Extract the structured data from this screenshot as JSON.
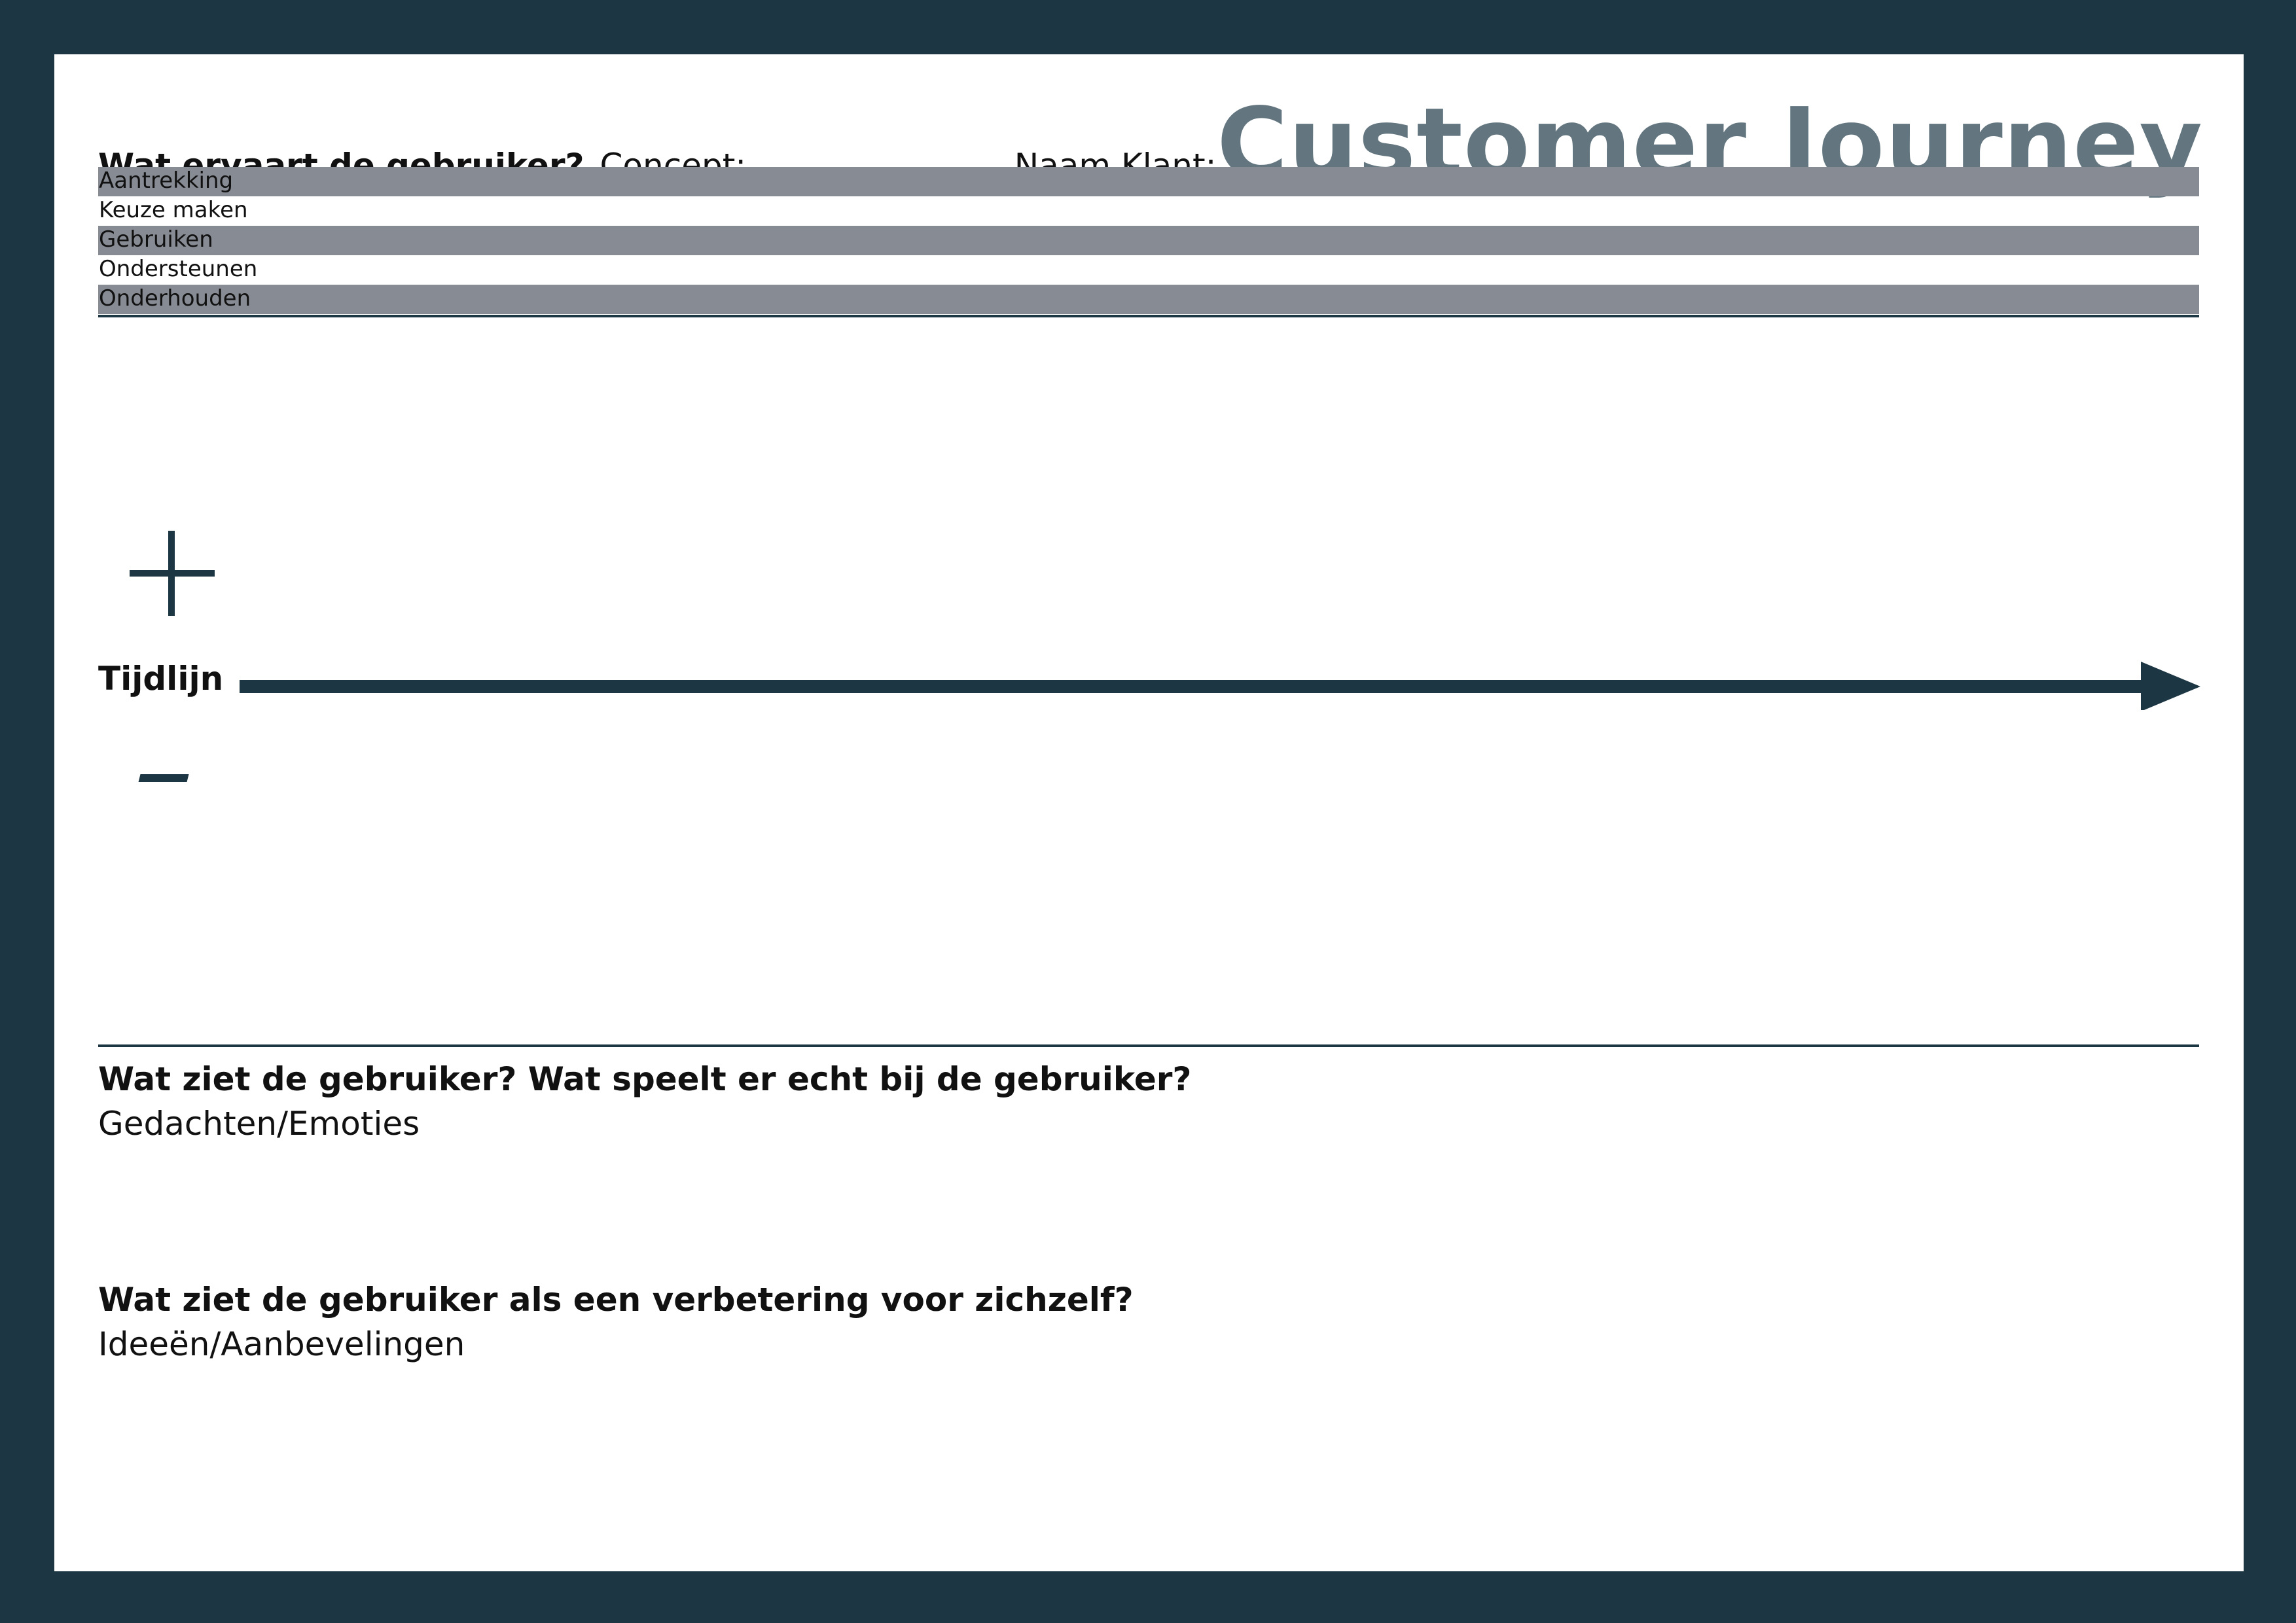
{
  "header": {
    "question": "Wat ervaart de gebruiker?",
    "concept_field": "Concept: ......................",
    "client_field": "Naam Klant: .................",
    "title": "Customer Journey"
  },
  "phases": [
    {
      "label": "Aantrekking",
      "shaded": true
    },
    {
      "label": "Keuze maken",
      "shaded": false
    },
    {
      "label": "Gebruiken",
      "shaded": true
    },
    {
      "label": "Ondersteunen",
      "shaded": false
    },
    {
      "label": "Onderhouden",
      "shaded": true
    }
  ],
  "timeline": {
    "label": "Tijdlijn",
    "positive_symbol": "+",
    "negative_symbol": "–"
  },
  "sections": [
    {
      "title": "Wat ziet de gebruiker? Wat speelt er echt bij de gebruiker?",
      "subtitle": "Gedachten/Emoties"
    },
    {
      "title": "Wat ziet de gebruiker als een verbetering voor zichzelf?",
      "subtitle": "Ideeën/Aanbevelingen"
    }
  ],
  "colors": {
    "frame": "#1c3644",
    "title": "#637680",
    "phase_band": "#878b93",
    "text": "#111111"
  }
}
